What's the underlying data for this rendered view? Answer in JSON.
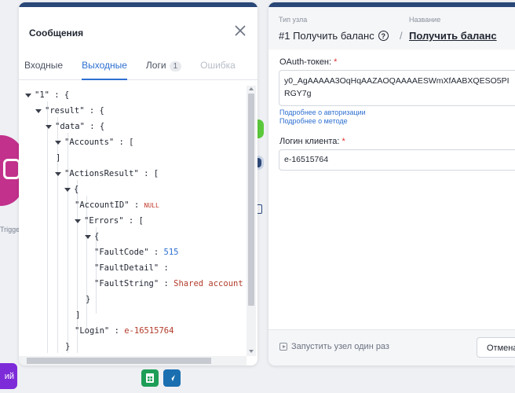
{
  "canvas": {
    "trigger_label": "Trigger",
    "purple_button_label": "ий"
  },
  "messages": {
    "title": "Сообщения",
    "tabs": [
      {
        "label": "Входные"
      },
      {
        "label": "Выходные"
      },
      {
        "label": "Логи",
        "badge": "1"
      },
      {
        "label": "Ошибка"
      }
    ],
    "json": {
      "key1": "\"1\"",
      "result": "\"result\"",
      "data": "\"data\"",
      "accounts": "\"Accounts\"",
      "actions_result": "\"ActionsResult\"",
      "account_id": "\"AccountID\"",
      "account_id_value": "NULL",
      "errors": "\"Errors\"",
      "fault_code": "\"FaultCode\"",
      "fault_code_value": "515",
      "fault_detail": "\"FaultDetail\"",
      "fault_string": "\"FaultString\"",
      "fault_string_value": "Shared account mus",
      "login": "\"Login\"",
      "login_value": "e-16515764"
    }
  },
  "node": {
    "type_caption": "Тип узла",
    "name_caption": "Название",
    "type_value": "#1 Получить баланс",
    "name_value": "Получить баланс",
    "oauth_label": "OAuth-токен:",
    "oauth_value_line1": "y0_AgAAAAA3OqHqAAZAOQAAAAESWmXfAABXQESO5PI",
    "oauth_value_line2": "RGY7g",
    "link_auth": "Подробнее о авторизации",
    "link_method": "Подробнее о методе",
    "login_label": "Логин клиента:",
    "login_value": "e-16515764",
    "run_once": "Запустить узел один раз",
    "cancel": "Отмена"
  }
}
